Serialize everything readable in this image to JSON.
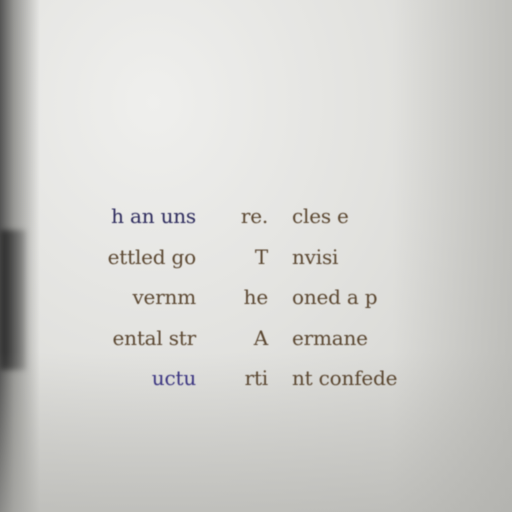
{
  "columns": [
    {
      "lines": [
        "h an uns",
        "ettled go",
        "vernm",
        "ental str",
        "uctu"
      ]
    },
    {
      "lines": [
        "re.",
        "T",
        "he",
        "A",
        "rti"
      ]
    },
    {
      "lines": [
        "cles e",
        "nvisi",
        "oned a p",
        "ermane",
        "nt confede"
      ]
    }
  ]
}
